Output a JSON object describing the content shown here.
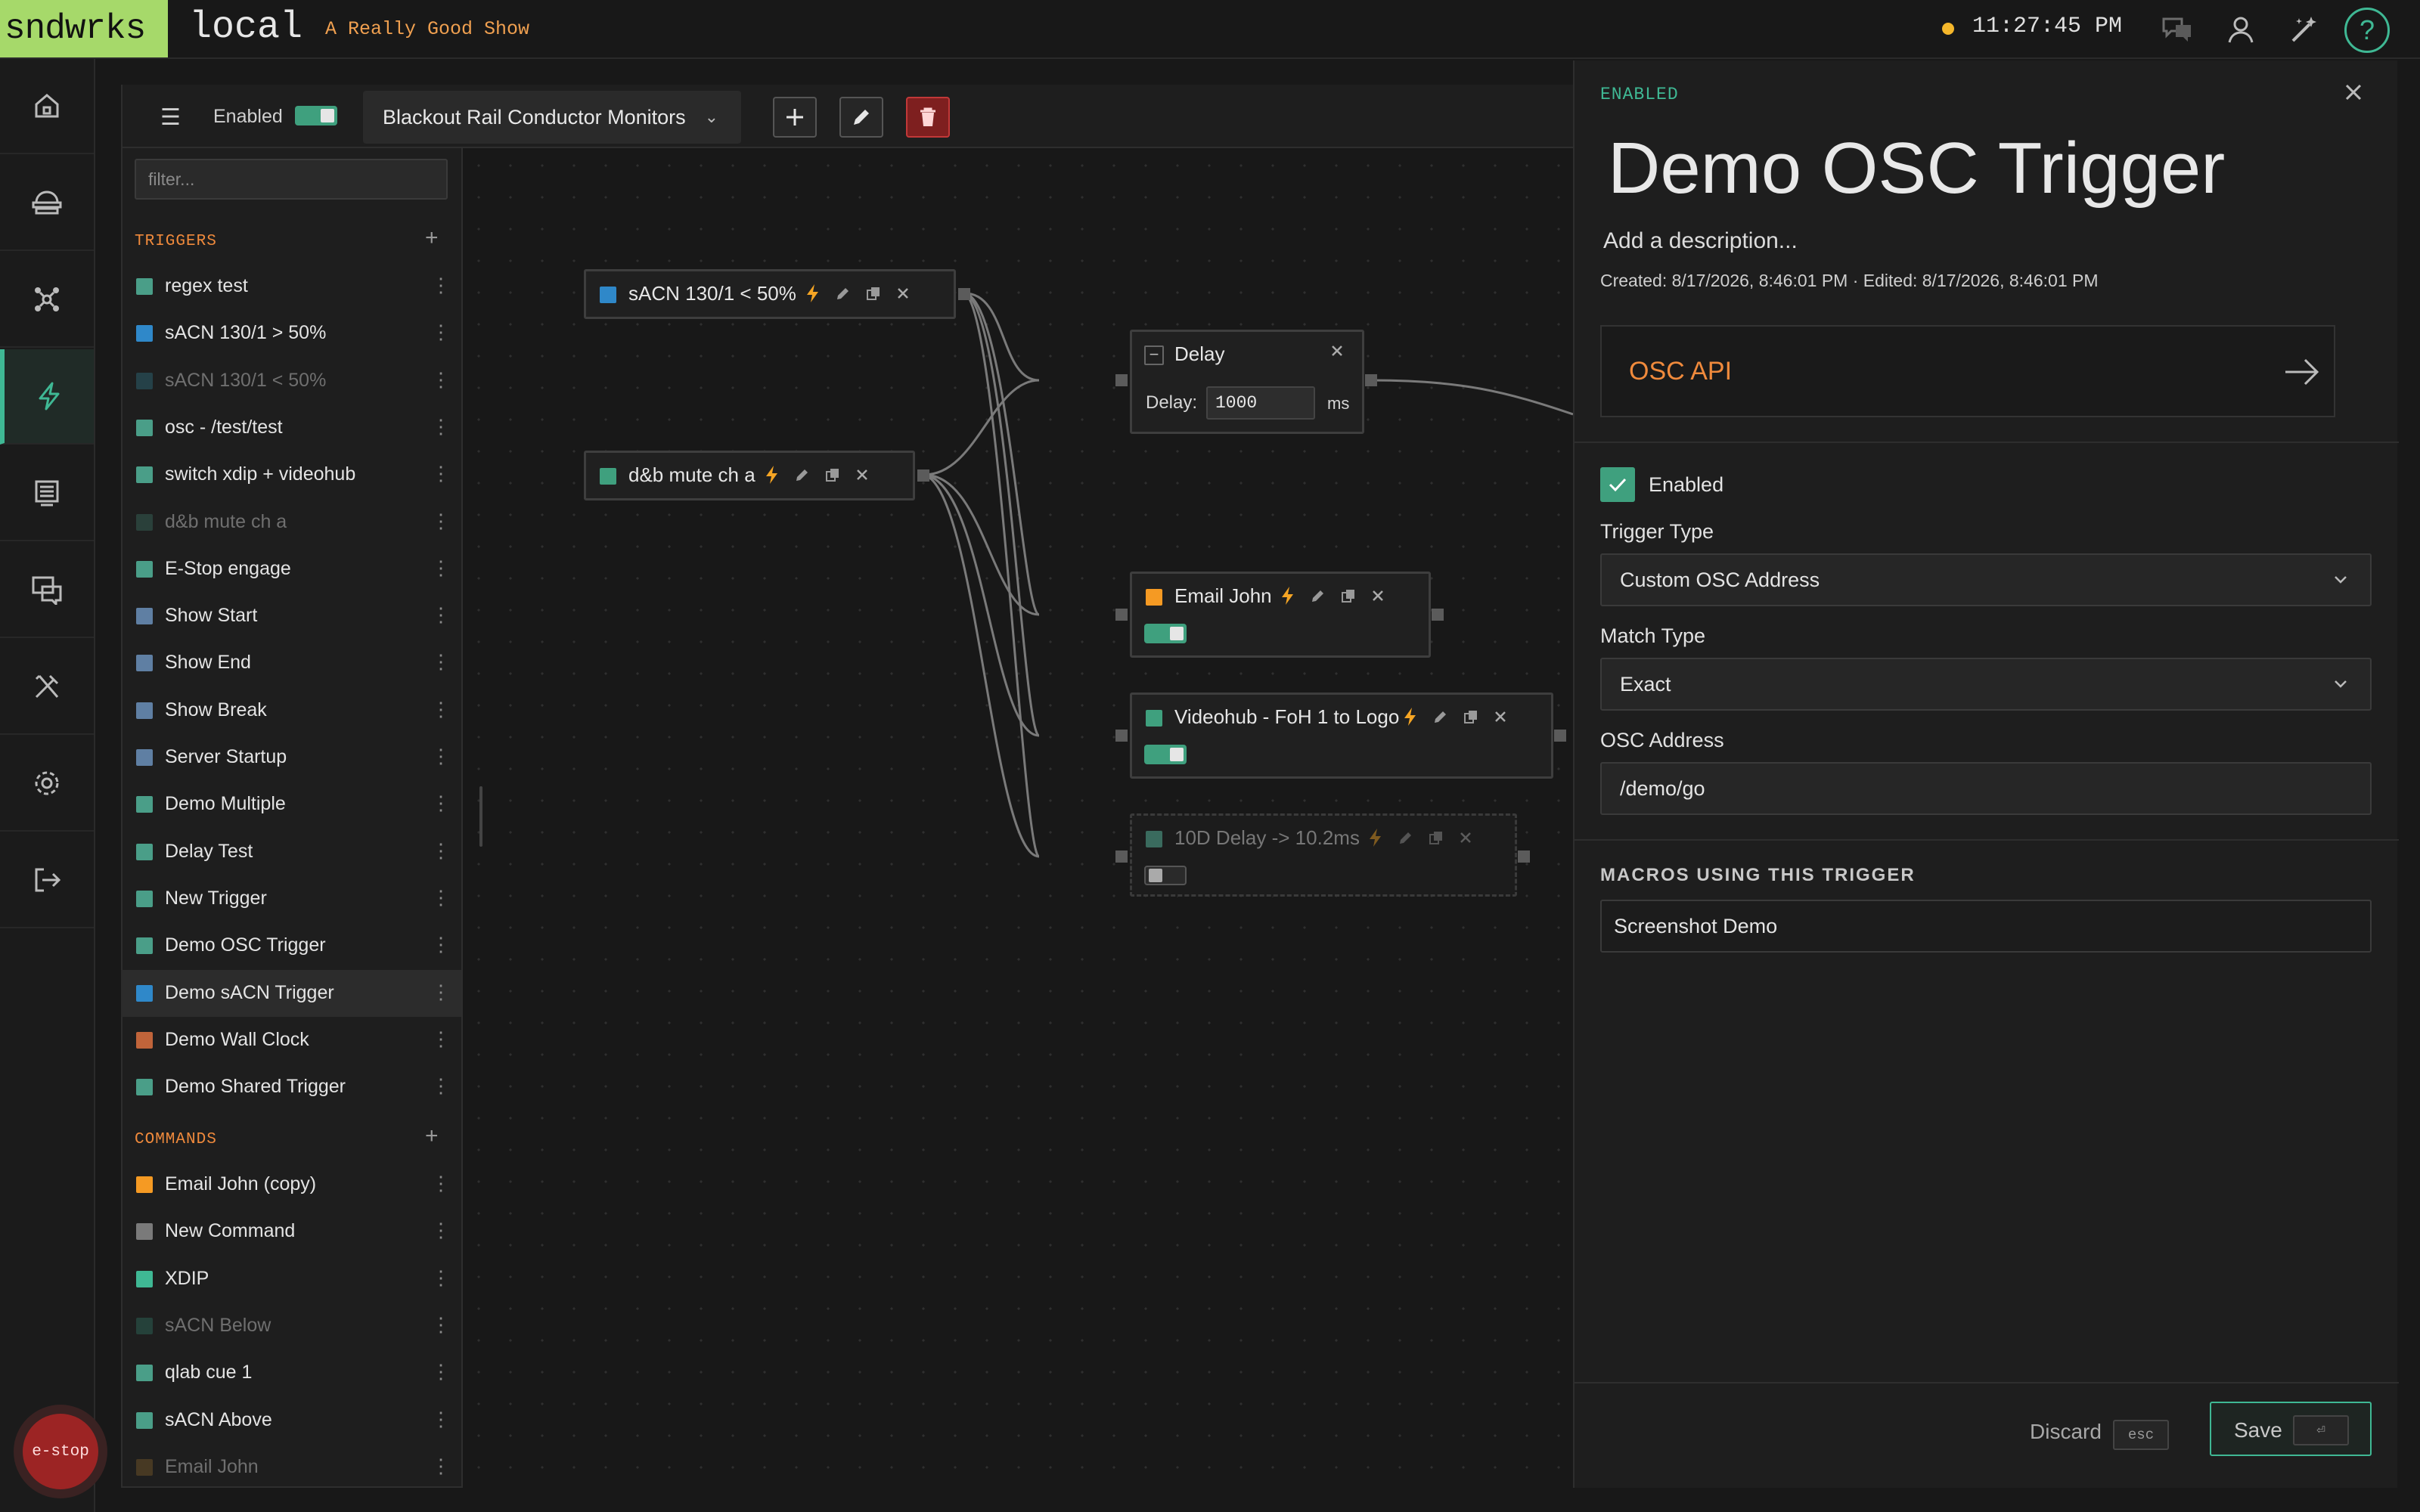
{
  "topbar": {
    "logo": "sndwrks",
    "instance": "local",
    "show_name": "A Really Good Show",
    "clock": "11:27:45 PM",
    "status_color": "#f5b72b"
  },
  "nav": [
    {
      "icon": "home-icon"
    },
    {
      "icon": "devices-icon"
    },
    {
      "icon": "network-icon"
    },
    {
      "icon": "lightning-icon",
      "active": true
    },
    {
      "icon": "monitor-icon"
    },
    {
      "icon": "chat-icon"
    },
    {
      "icon": "tools-icon"
    },
    {
      "icon": "gear-icon"
    },
    {
      "icon": "logout-icon"
    }
  ],
  "estop": {
    "label": "e-stop"
  },
  "toolbar": {
    "enabled_label": "Enabled",
    "macro_name": "Blackout Rail Conductor Monitors"
  },
  "sidebar": {
    "filter_placeholder": "filter...",
    "triggers_heading": "TRIGGERS",
    "commands_heading": "COMMANDS",
    "triggers": [
      {
        "label": "regex test",
        "color": "#4a9e88"
      },
      {
        "label": "sACN 130/1 > 50%",
        "color": "#2f88c9"
      },
      {
        "label": "sACN 130/1 < 50%",
        "color": "#2f6c7c",
        "dim": true
      },
      {
        "label": "osc - /test/test",
        "color": "#4a9e88"
      },
      {
        "label": "switch xdip + videohub",
        "color": "#4a9e88"
      },
      {
        "label": "d&b mute ch a",
        "color": "#3a6b5e",
        "dim": true
      },
      {
        "label": "E-Stop engage",
        "color": "#4a9e88"
      },
      {
        "label": "Show Start",
        "color": "#5f7fa3"
      },
      {
        "label": "Show End",
        "color": "#5f7fa3"
      },
      {
        "label": "Show Break",
        "color": "#5f7fa3"
      },
      {
        "label": "Server Startup",
        "color": "#5f7fa3"
      },
      {
        "label": "Demo Multiple",
        "color": "#4a9e88"
      },
      {
        "label": "Delay Test",
        "color": "#4a9e88"
      },
      {
        "label": "New Trigger",
        "color": "#4a9e88"
      },
      {
        "label": "Demo OSC Trigger",
        "color": "#4a9e88"
      },
      {
        "label": "Demo sACN Trigger",
        "color": "#2f88c9",
        "selected": true
      },
      {
        "label": "Demo Wall Clock",
        "color": "#c0643a"
      },
      {
        "label": "Demo Shared Trigger",
        "color": "#4a9e88"
      }
    ],
    "commands": [
      {
        "label": "Email John (copy)",
        "color": "#f59a23"
      },
      {
        "label": "New Command",
        "color": "#7a7a7a"
      },
      {
        "label": "XDIP",
        "color": "#3fb894"
      },
      {
        "label": "sACN Below",
        "color": "#2f6c5e",
        "dim": true
      },
      {
        "label": "qlab cue 1",
        "color": "#4a9e88"
      },
      {
        "label": "sACN Above",
        "color": "#4a9e88"
      },
      {
        "label": "Email John",
        "color": "#7a5a2a",
        "dim": true
      }
    ]
  },
  "canvas": {
    "nodes": {
      "sacn": {
        "label": "sACN 130/1 < 50%",
        "color": "#2f88c9"
      },
      "db": {
        "label": "d&b mute ch a",
        "color": "#3fa07e"
      },
      "delay": {
        "label": "Delay",
        "field_label": "Delay:",
        "value": "1000",
        "unit": "ms"
      },
      "email": {
        "label": "Email John",
        "color": "#f59a23",
        "toggle_on": true
      },
      "videohub": {
        "label": "Videohub - FoH 1 to Logo",
        "color": "#3fa07e",
        "toggle_on": true
      },
      "tend": {
        "label": "10D Delay -> 10.2ms",
        "color": "#3a6b5e",
        "toggle_on": false
      }
    }
  },
  "detail": {
    "status": "ENABLED",
    "title": "Demo OSC Trigger",
    "description": "Add a description...",
    "meta": "Created: 8/17/2026, 8:46:01 PM · Edited: 8/17/2026, 8:46:01 PM",
    "protocol": "OSC API",
    "enabled_label": "Enabled",
    "trigger_type_label": "Trigger Type",
    "trigger_type": "Custom OSC Address",
    "match_type_label": "Match Type",
    "match_type": "Exact",
    "osc_address_label": "OSC Address",
    "osc_address": "/demo/go",
    "macros_heading": "MACROS USING THIS TRIGGER",
    "macros": [
      "Screenshot Demo"
    ],
    "discard_label": "Discard",
    "discard_key": "esc",
    "save_label": "Save",
    "save_key": "⏎"
  }
}
